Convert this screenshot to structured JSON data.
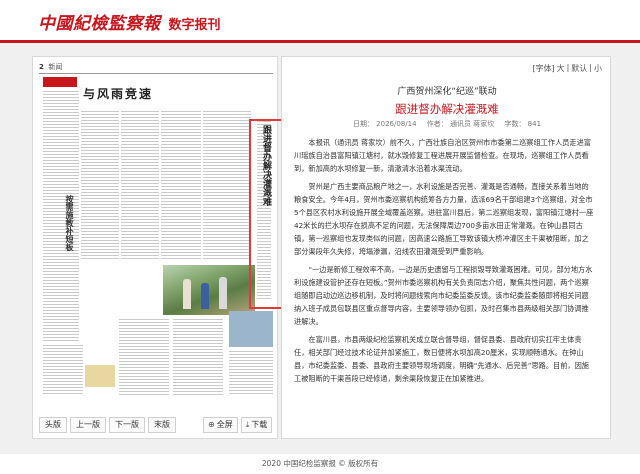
{
  "header": {
    "logo": "中國紀檢監察報",
    "subtitle": "数字报刊"
  },
  "paper": {
    "page_label": "2",
    "page_name": "新闻",
    "headline": "与风雨竞速",
    "left_tag": "一线观察",
    "left_vertical_title": "按需施教补短板",
    "highlight_vertical_title": "跟进督办解决灌溉难",
    "pager": {
      "first": "头版",
      "prev": "上一版",
      "next": "下一版",
      "last": "末版",
      "zoom": "全屏",
      "download": "下载"
    }
  },
  "article": {
    "font_controls": [
      "[字体]",
      "大",
      "|",
      "默认",
      "|",
      "小"
    ],
    "overline": "广西贺州深化“纪巡”联动",
    "headline": "跟进督办解决灌溉难",
    "meta": {
      "date": "日期：  2026/08/14",
      "author": "作者：  通讯员 蒋家坎",
      "words": "字数：  841"
    },
    "paragraphs": [
      "本报讯（通讯员 蒋家坎）前不久，广西壮族自治区贺州市市委第二巡察组工作人员走进富川瑶族自治县富阳镇江塘村，就水毁修复工程进展开展监督检查。在现场，巡察组工作人员看到，新加高的水坝修复一新，清澈清水沿着水渠流动。",
      "贺州是广西主要商品粮产地之一，水利设施是否完善、灌溉是否通畅，直接关系着当地的粮食安全。今年4月，贺州市委巡察机构统筹各方力量，选派69名干部组建3个巡察组，对全市5个县区农村水利设施开展全域覆盖巡察。进驻富川县后，第二巡察组发现，富阳镇江塘村一座42米长的拦水坝存在损高不足的问题，无法保障周边700多亩水田正常灌溉。在钟山县同古镇，第一巡察组也发现类似的问题，因高速公路施工导致该镇大桥冲灌区主干渠被阻断，加之部分渠段年久失修，垮塌渗漏，沿线农田灌溉受到严重影响。",
      "“一边是新修工程效率不高，一边是历史遗留与工程损毁导致灌溉困难。可见，部分地方水利设施建设管护还存在短板。”贺州市委巡察机构有关负责同志介绍，聚焦共性问题，两个巡察组随即启动边巡边移机制，及时将问题线索向市纪委监委反馈。该市纪委监委随即将相关问题纳入班子成员包联县区重点督导内容，主要领导领办包抓，及时召集市县两级相关部门协调推进解决。",
      "在富川县，市县两级纪检监察机关成立联合督导组，督促县委、县政府切实扛牢主体责任，相关部门经过技术论证并加紧施工，数日便将水坝加高20厘米，实现顺畅通水。在钟山县，市纪委监委、县委、县政府主要领导现场调度，明确“先通水、后完善”思路。目前，因施工被阻断的干渠首段已经修通，剩余渠段恢复正在加紧推进。"
    ]
  },
  "footer": {
    "copyright": "2020 中国纪检监察报 © 版权所有"
  },
  "colors": {
    "brand_red": "#c8161d",
    "highlight_border": "#e23a3a"
  }
}
